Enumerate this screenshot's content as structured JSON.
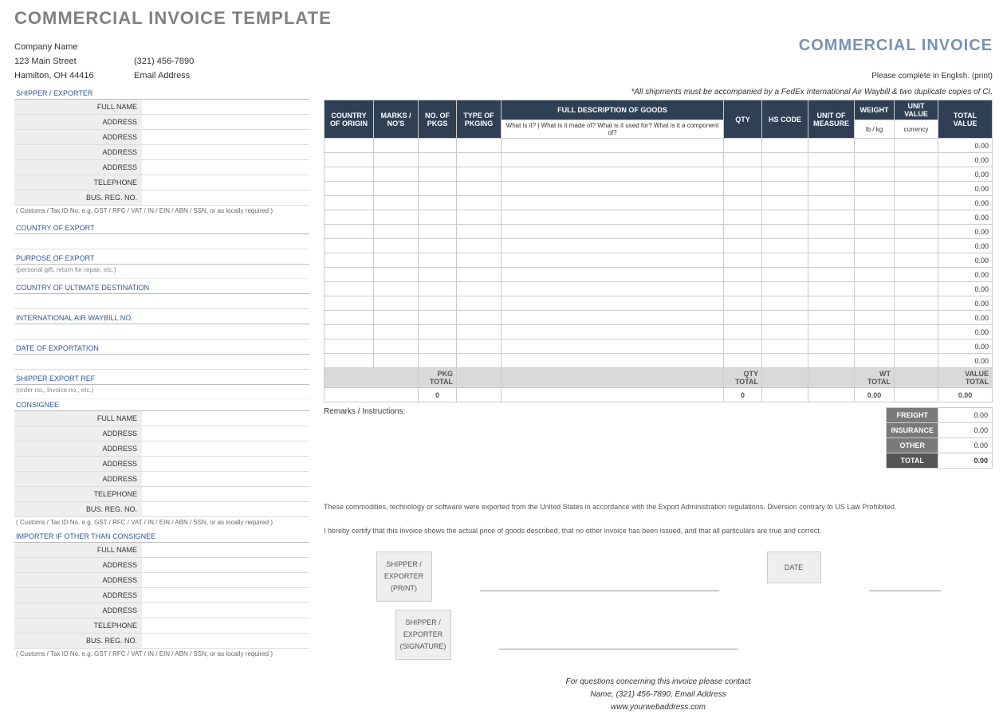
{
  "title": "COMMERCIAL INVOICE TEMPLATE",
  "header_right": "COMMERCIAL INVOICE",
  "header_sub": "Please complete in English. (print)",
  "company": {
    "name": "Company Name",
    "street": "123 Main Street",
    "phone": "(321) 456-7890",
    "city": "Hamilton, OH  44416",
    "email": "Email Address"
  },
  "notice": "*All shipments must be accompanied by a FedEx International Air Waybill & two duplicate copies of CI.",
  "sections": {
    "shipper": "SHIPPER / EXPORTER",
    "consignee": "CONSIGNEE",
    "importer": "IMPORTER IF OTHER THAN CONSIGNEE",
    "country_export": "COUNTRY OF EXPORT",
    "purpose": "PURPOSE OF EXPORT",
    "purpose_note": "(personal gift, return for repair, etc.)",
    "ultimate": "COUNTRY OF ULTIMATE DESTINATION",
    "awb": "INTERNATIONAL AIR WAYBILL NO.",
    "date_export": "DATE OF EXPORTATION",
    "ship_ref": "SHIPPER EXPORT REF",
    "ship_ref_note": "(order no., invoice no., etc.)"
  },
  "entity_fields": [
    "FULL NAME",
    "ADDRESS",
    "ADDRESS",
    "ADDRESS",
    "ADDRESS",
    "TELEPHONE",
    "BUS. REG. NO."
  ],
  "reg_note": "( Customs / Tax ID No. e.g. GST / RFC / VAT / IN / EIN / ABN / SSN, or as locally required )",
  "table": {
    "h": {
      "country": "COUNTRY OF ORIGIN",
      "marks": "MARKS / NO'S",
      "pkgs": "NO. OF PKGS",
      "type": "TYPE OF PKGING",
      "desc": "FULL DESCRIPTION OF GOODS",
      "desc_sub": "What is it?  |  What is it made of?  What is it used for?  What is it a component of?",
      "qty": "QTY",
      "hs": "HS CODE",
      "um": "UNIT OF MEASURE",
      "weight": "WEIGHT",
      "weight_sub": "lb / kg",
      "uv": "UNIT VALUE",
      "uv_sub": "currency",
      "tv": "TOTAL VALUE"
    },
    "rows": [
      "0.00",
      "0.00",
      "0.00",
      "0.00",
      "0.00",
      "0.00",
      "0.00",
      "0.00",
      "0.00",
      "0.00",
      "0.00",
      "0.00",
      "0.00",
      "0.00",
      "0.00",
      "0.00"
    ],
    "totals": {
      "pkg_label": "PKG TOTAL",
      "pkg": "0",
      "qty_label": "QTY TOTAL",
      "qty": "0",
      "wt_label": "WT TOTAL",
      "wt": "0.00",
      "val_label": "VALUE TOTAL",
      "val": "0.00"
    }
  },
  "remarks_label": "Remarks / Instructions:",
  "summary": {
    "freight": "FREIGHT",
    "freight_v": "0.00",
    "ins": "INSURANCE",
    "ins_v": "0.00",
    "other": "OTHER",
    "other_v": "0.00",
    "total": "TOTAL",
    "total_v": "0.00"
  },
  "legal1": "These commodities, technology or software were exported from the United States in accordance with the Export Administration regulations.  Diversion contrary to US Law Prohibited.",
  "legal2": "I hereby certify that this invoice shows the actual price of goods described, that no other invoice has been issued, and that all particulars are true and correct.",
  "sig1": "SHIPPER / EXPORTER (PRINT)",
  "sig2": "SHIPPER / EXPORTER (SIGNATURE)",
  "date_label": "DATE",
  "footer": {
    "l1": "For questions concerning this invoice please contact",
    "l2": "Name, (321) 456-7890, Email Address",
    "l3": "www.yourwebaddress.com"
  }
}
